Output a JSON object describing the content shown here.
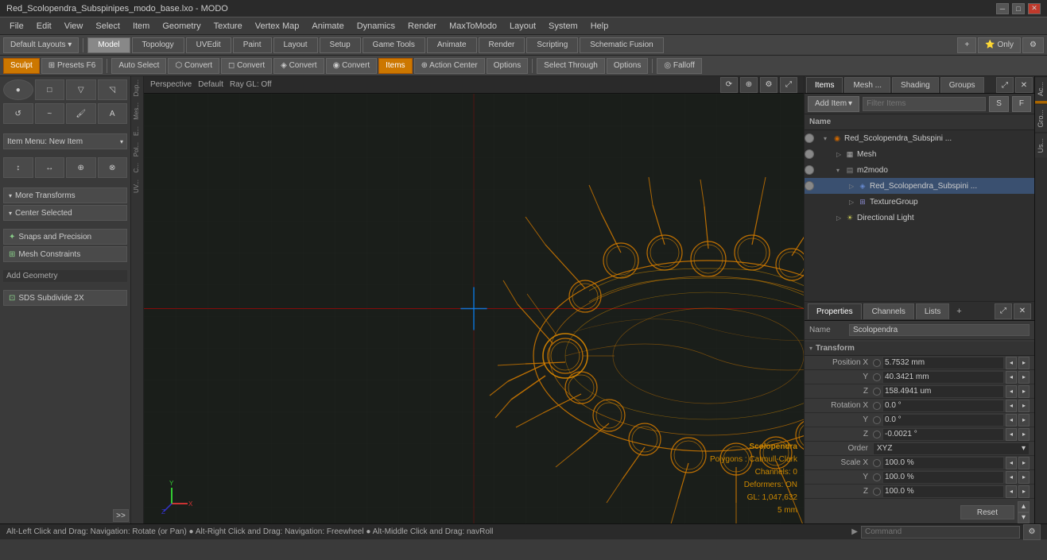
{
  "titlebar": {
    "title": "Red_Scolopendra_Subspinipes_modo_base.lxo - MODO"
  },
  "menubar": {
    "items": [
      "File",
      "Edit",
      "View",
      "Select",
      "Item",
      "Geometry",
      "Texture",
      "Vertex Map",
      "Animate",
      "Dynamics",
      "Render",
      "MaxToModo",
      "Layout",
      "System",
      "Help"
    ]
  },
  "toolbar1": {
    "layout_btn": "Default Layouts ▾",
    "tabs": [
      "Model",
      "Topology",
      "UVEdit",
      "Paint",
      "Layout",
      "Setup",
      "Game Tools",
      "Animate",
      "Render",
      "Scripting",
      "Schematic Fusion"
    ],
    "active_tab": "Model",
    "add_btn": "+"
  },
  "toolbar2": {
    "sculpt_btn": "Sculpt",
    "presets_btn": "Presets F6",
    "auto_select": "Auto Select",
    "convert_btns": [
      "Convert",
      "Convert",
      "Convert",
      "Convert"
    ],
    "items_btn": "Items",
    "action_center": "Action Center",
    "options1": "Options",
    "select_through": "Select Through",
    "options2": "Options"
  },
  "viewport": {
    "perspective": "Perspective",
    "default": "Default",
    "ray_gl": "Ray GL: Off"
  },
  "left_panel": {
    "item_menu": "Item Menu: New Item",
    "more_transforms": "More Transforms",
    "center_selected": "Center Selected",
    "snaps": "Snaps and Precision",
    "mesh_constraints": "Mesh Constraints",
    "add_geometry": "Add Geometry",
    "sds_subdivide": "SDS Subdivide 2X"
  },
  "scene_info": {
    "name": "Scolopendra",
    "polygons": "Polygons : Catmull-Clark",
    "channels": "Channels: 0",
    "deformers": "Deformers: ON",
    "gl_polys": "GL: 1,047,632",
    "scale": "5 mm"
  },
  "right_panel": {
    "tabs": [
      "Items",
      "Mesh ...",
      "Shading",
      "Groups"
    ],
    "active_tab": "Items",
    "add_item_btn": "Add Item",
    "filter_placeholder": "Filter Items",
    "s_btn": "S",
    "f_btn": "F",
    "tree_header": "Name",
    "tree_items": [
      {
        "indent": 0,
        "label": "Red_Scolopendra_Subspini ...",
        "type": "mesh-icon",
        "has_eye": true,
        "expanded": true,
        "color": "#cc6600"
      },
      {
        "indent": 1,
        "label": "Mesh",
        "type": "mesh-icon",
        "has_eye": true,
        "expanded": false
      },
      {
        "indent": 1,
        "label": "m2modo",
        "type": "folder-icon",
        "has_eye": true,
        "expanded": true
      },
      {
        "indent": 2,
        "label": "Red_Scolopendra_Subspini ...",
        "type": "mesh-icon",
        "has_eye": true,
        "expanded": false,
        "selected": true
      },
      {
        "indent": 2,
        "label": "TextureGroup",
        "type": "texture-icon",
        "has_eye": false,
        "expanded": false
      },
      {
        "indent": 1,
        "label": "Directional Light",
        "type": "light-icon",
        "has_eye": false,
        "expanded": false
      }
    ]
  },
  "properties": {
    "tabs": [
      "Properties",
      "Channels",
      "Lists"
    ],
    "active_tab": "Properties",
    "add_btn": "+",
    "name_label": "Name",
    "name_value": "Scolopendra",
    "section_transform": "Transform",
    "position": {
      "x": "5.7532 mm",
      "y": "40.3421 mm",
      "z": "158.4941 um"
    },
    "rotation": {
      "x": "0.0 °",
      "y": "0.0 °",
      "z": "-0.0021 °"
    },
    "order_label": "Order",
    "order_value": "XYZ",
    "scale": {
      "x": "100.0 %",
      "y": "100.0 %",
      "z": "100.0 %"
    },
    "reset_btn": "Reset"
  },
  "statusbar": {
    "text": "Alt-Left Click and Drag: Navigation: Rotate (or Pan) ● Alt-Right Click and Drag: Navigation: Freewheel ● Alt-Middle Click and Drag: navRoll",
    "cmd_placeholder": "Command"
  },
  "side_tabs": [
    "Ac...",
    "Gro...",
    "Us..."
  ]
}
